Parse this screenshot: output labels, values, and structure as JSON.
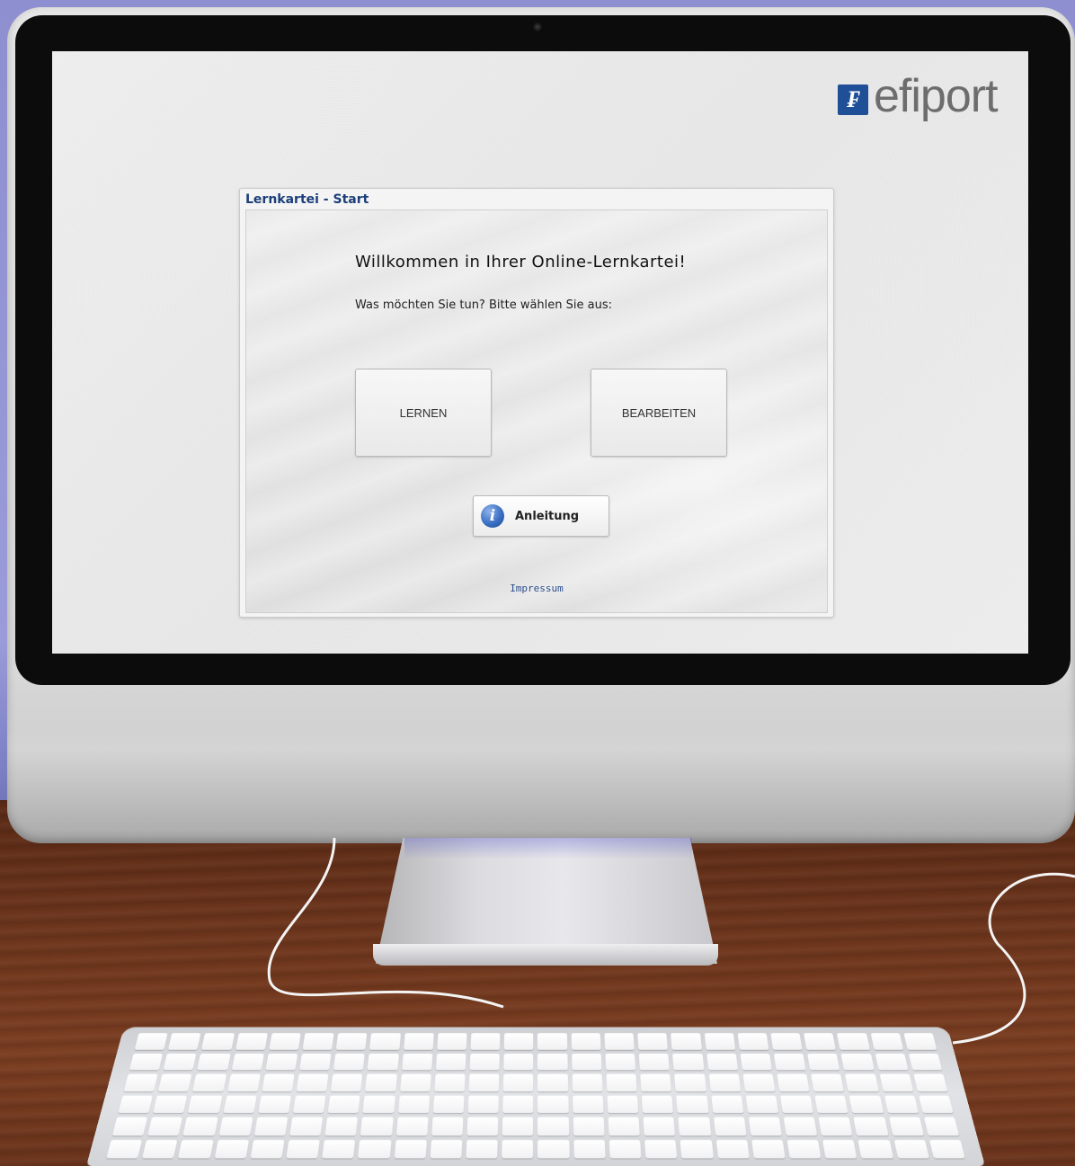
{
  "screen": {
    "brand": {
      "logo_mark": "₣",
      "name": "efiport"
    },
    "window": {
      "title": "Lernkartei - Start",
      "heading": "Willkommen in Ihrer Online-Lernkartei!",
      "prompt": "Was möchten Sie tun? Bitte wählen Sie aus:",
      "buttons": {
        "learn": "LERNEN",
        "edit": "BEARBEITEN",
        "help": "Anleitung"
      },
      "help_icon": "i",
      "footer_link": "Impressum"
    }
  },
  "colors": {
    "brand_blue": "#1f4f97",
    "title_blue": "#1c3f7a",
    "link_blue": "#2b4f8f"
  },
  "icons": {
    "help": "info-icon",
    "brand": "efiport-logo-icon"
  }
}
